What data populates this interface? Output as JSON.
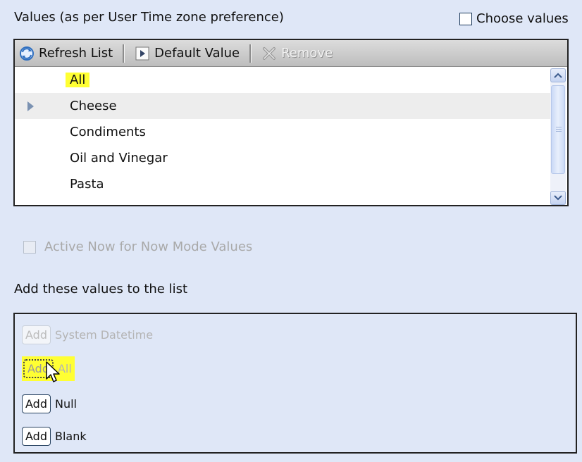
{
  "header": {
    "values_label": "Values (as per User Time zone preference)",
    "choose_values_label": "Choose values"
  },
  "toolbar": {
    "refresh_label": "Refresh List",
    "default_label": "Default Value",
    "remove_label": "Remove"
  },
  "list": {
    "items": [
      {
        "label": "All",
        "highlighted": true
      },
      {
        "label": "Cheese",
        "selected": true
      },
      {
        "label": "Condiments"
      },
      {
        "label": "Oil and Vinegar"
      },
      {
        "label": "Pasta"
      }
    ]
  },
  "active_now": {
    "label": "Active Now for Now Mode Values"
  },
  "add_section": {
    "title": "Add these values to the list",
    "button_label": "Add",
    "rows": [
      {
        "label": "System Datetime",
        "state": "disabled"
      },
      {
        "label": "All",
        "state": "focused-disabled"
      },
      {
        "label": "Null",
        "state": "enabled"
      },
      {
        "label": "Blank",
        "state": "enabled"
      }
    ]
  },
  "colors": {
    "background": "#dfe7f7",
    "highlight": "#ffff33",
    "toolbar": "#c9c9c9"
  },
  "icons": {
    "refresh": "refresh-icon",
    "default": "play-icon",
    "remove": "x-remove-icon",
    "scroll_up": "chevron-up-icon",
    "scroll_down": "chevron-down-icon",
    "cursor": "mouse-pointer-icon"
  }
}
